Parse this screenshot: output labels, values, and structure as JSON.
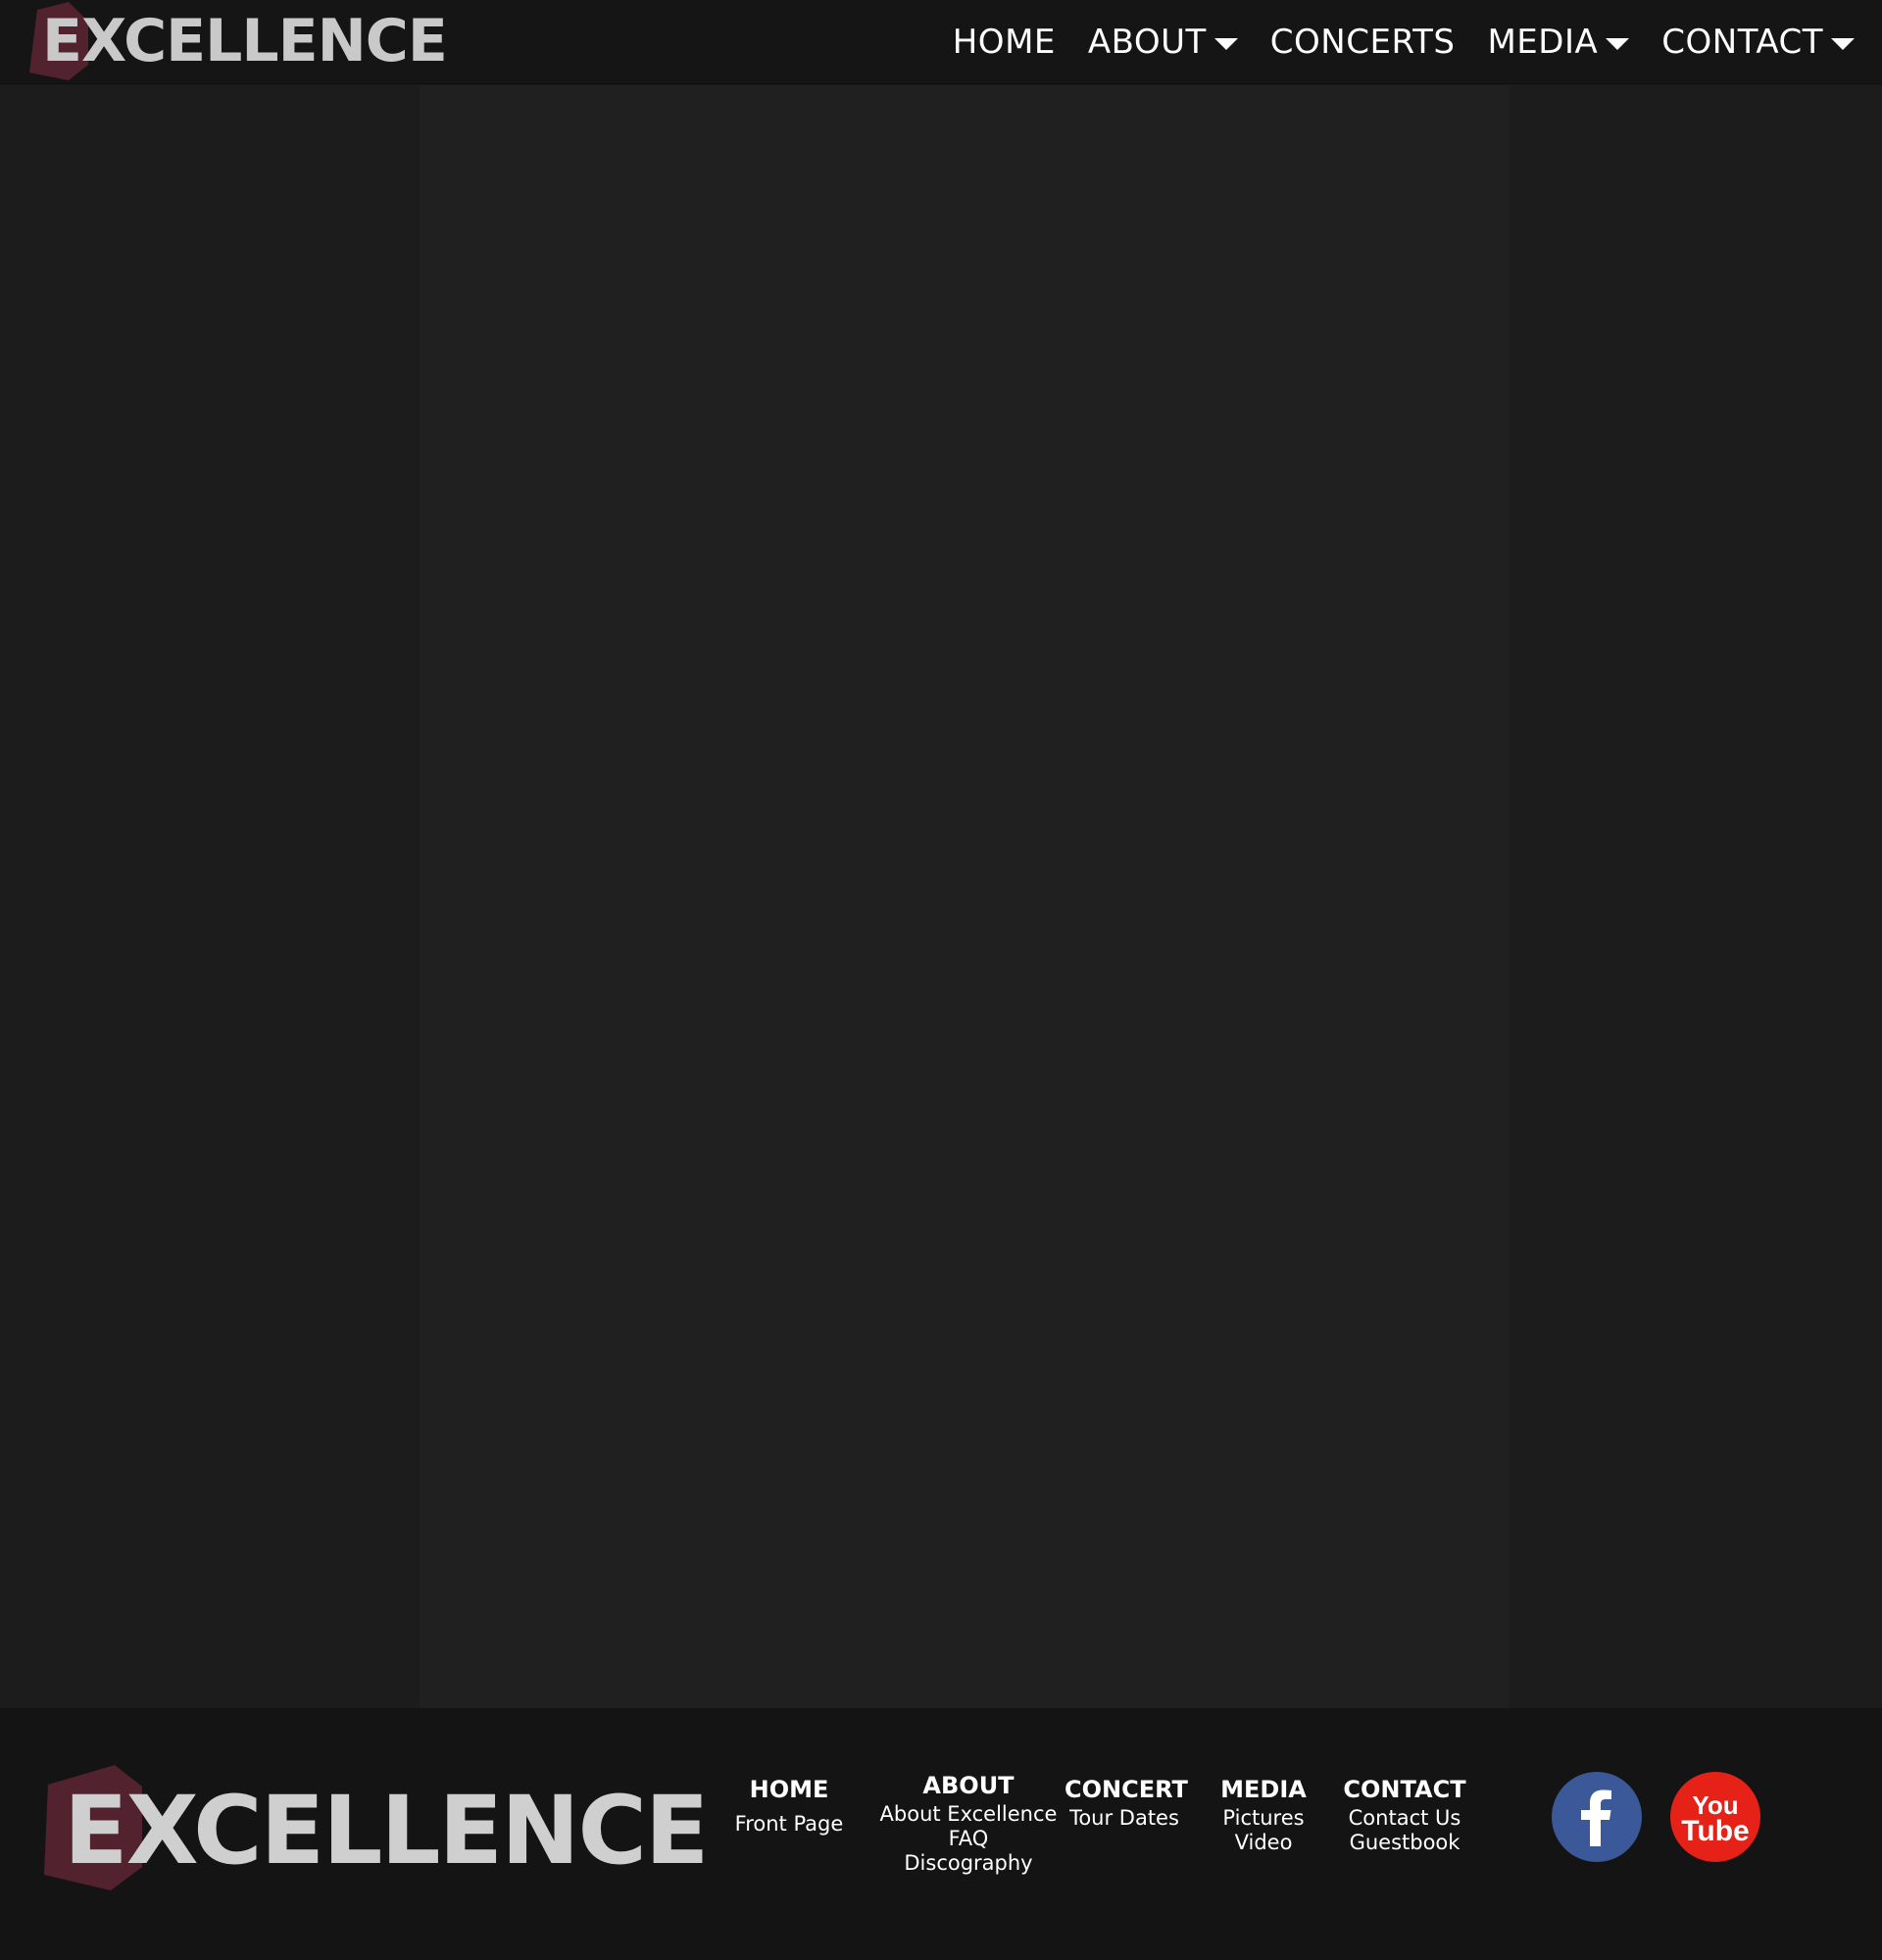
{
  "header": {
    "logo_text": "EXCELLENCE",
    "nav": [
      {
        "label": "HOME",
        "dropdown": false
      },
      {
        "label": "ABOUT",
        "dropdown": true
      },
      {
        "label": "CONCERTS",
        "dropdown": false
      },
      {
        "label": "MEDIA",
        "dropdown": true
      },
      {
        "label": "CONTACT",
        "dropdown": true
      }
    ]
  },
  "footer": {
    "logo_text": "EXCELLENCE",
    "columns": [
      {
        "heading": "HOME",
        "links": [
          "Front Page"
        ]
      },
      {
        "heading": "ABOUT",
        "links": [
          "About Excellence",
          "FAQ",
          "Discography"
        ]
      },
      {
        "heading": "CONCERT",
        "links": [
          "Tour Dates"
        ]
      },
      {
        "heading": "MEDIA",
        "links": [
          "Pictures",
          "Video"
        ]
      },
      {
        "heading": "CONTACT",
        "links": [
          "Contact Us",
          "Guestbook"
        ]
      }
    ],
    "social": [
      {
        "icon": "facebook-icon",
        "color": "#3b5998"
      },
      {
        "icon": "youtube-icon",
        "color": "#e62117",
        "text_top": "You",
        "text_bottom": "Tube"
      }
    ]
  },
  "colors": {
    "header_bg": "#151515",
    "content_bg": "#202020",
    "side_bg": "#1c1c1c",
    "footer_bg": "#141414",
    "logo_hex": "#5a2332",
    "logo_text": "#c9c9c9"
  }
}
